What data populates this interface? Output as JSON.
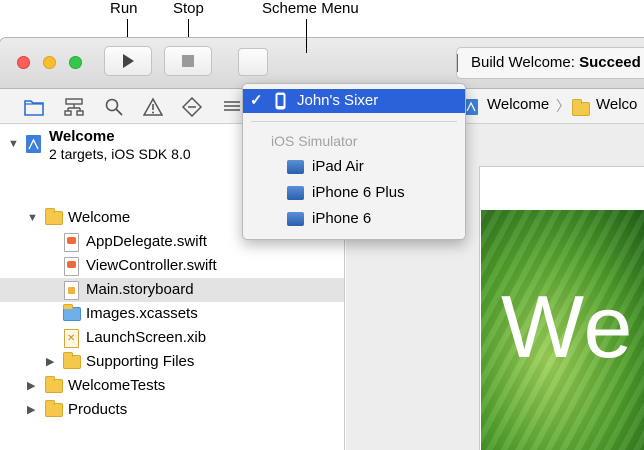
{
  "callouts": {
    "run": "Run",
    "stop": "Stop",
    "scheme_menu": "Scheme Menu"
  },
  "window": {
    "traffic_lights": {
      "close": "#fc5f57",
      "minimize": "#fdbc2e",
      "zoom": "#34c84a"
    }
  },
  "toolbar": {
    "run_icon": "play-icon",
    "stop_icon": "stop-icon",
    "activity_label": "Build Welcome: ",
    "activity_status": "Succeed"
  },
  "navigator_tabs": [
    "folder-icon",
    "hierarchy-icon",
    "search-icon",
    "warning-icon",
    "test-icon",
    "debug-icon"
  ],
  "jump_bar": {
    "project": "Welcome",
    "folder": "Welco"
  },
  "project": {
    "name": "Welcome",
    "subtitle": "2 targets, iOS SDK 8.0"
  },
  "tree": {
    "group": "Welcome",
    "files": {
      "app_delegate": "AppDelegate.swift",
      "view_controller": "ViewController.swift",
      "main_storyboard": "Main.storyboard",
      "images": "Images.xcassets",
      "launch_screen": "LaunchScreen.xib",
      "supporting": "Supporting Files"
    },
    "tests": "WelcomeTests",
    "products": "Products"
  },
  "canvas": {
    "big_text": "We"
  },
  "scheme_menu": {
    "selected": "John's Sixer",
    "checkmark": "✓",
    "section_header": "iOS Simulator",
    "simulators": [
      "iPad Air",
      "iPhone 6 Plus",
      "iPhone 6"
    ],
    "highlight_color": "#2b62d9"
  }
}
